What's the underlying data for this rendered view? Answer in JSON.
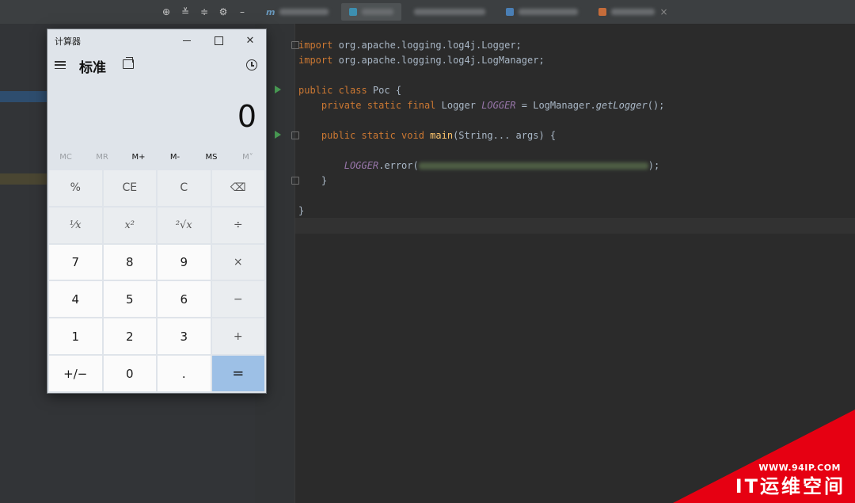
{
  "calculator": {
    "window_title": "计算器",
    "mode_title": "标准",
    "display_value": "0",
    "memory_buttons": [
      {
        "label": "MC",
        "enabled": false
      },
      {
        "label": "MR",
        "enabled": false
      },
      {
        "label": "M+",
        "enabled": true
      },
      {
        "label": "M-",
        "enabled": true
      },
      {
        "label": "MS",
        "enabled": true
      },
      {
        "label": "M˅",
        "enabled": false
      }
    ],
    "keys": [
      {
        "label": "%",
        "kind": "op"
      },
      {
        "label": "CE",
        "kind": "op"
      },
      {
        "label": "C",
        "kind": "op"
      },
      {
        "label": "⌫",
        "kind": "op"
      },
      {
        "label": "⅟x",
        "kind": "fn"
      },
      {
        "label": "x²",
        "kind": "fn"
      },
      {
        "label": "²√x",
        "kind": "fn"
      },
      {
        "label": "÷",
        "kind": "op"
      },
      {
        "label": "7",
        "kind": "num"
      },
      {
        "label": "8",
        "kind": "num"
      },
      {
        "label": "9",
        "kind": "num"
      },
      {
        "label": "×",
        "kind": "op"
      },
      {
        "label": "4",
        "kind": "num"
      },
      {
        "label": "5",
        "kind": "num"
      },
      {
        "label": "6",
        "kind": "num"
      },
      {
        "label": "−",
        "kind": "op"
      },
      {
        "label": "1",
        "kind": "num"
      },
      {
        "label": "2",
        "kind": "num"
      },
      {
        "label": "3",
        "kind": "num"
      },
      {
        "label": "+",
        "kind": "op"
      },
      {
        "label": "+/−",
        "kind": "num"
      },
      {
        "label": "0",
        "kind": "num"
      },
      {
        "label": ".",
        "kind": "num"
      },
      {
        "label": "=",
        "kind": "equals"
      }
    ]
  },
  "editor": {
    "code": {
      "import1_kw": "import",
      "import1_rest": " org.apache.logging.log4j.Logger;",
      "import2_kw": "import",
      "import2_rest": " org.apache.logging.log4j.LogManager;",
      "class_kw": "public class",
      "class_name": " Poc {",
      "field_kw": "    private static final",
      "field_type": " Logger ",
      "field_name": "LOGGER",
      "field_assign": " = LogManager.",
      "field_call": "getLogger",
      "field_end": "();",
      "main_kw": "    public static void",
      "main_name": " main",
      "main_sig": "(String... args) {",
      "call_obj": "        LOGGER",
      "call_method": ".error(",
      "call_end": ");",
      "close_method": "    }",
      "close_class": "}"
    },
    "active_tab_prefix": "m"
  },
  "watermark": {
    "url": "WWW.94IP.COM",
    "name": "IT运维空间"
  },
  "colors": {
    "calculator_bg": "#dfe4ea",
    "equals_key": "#9dc0e6",
    "editor_bg": "#2b2b2b",
    "keyword": "#cc7832",
    "watermark_red": "#e60012"
  }
}
